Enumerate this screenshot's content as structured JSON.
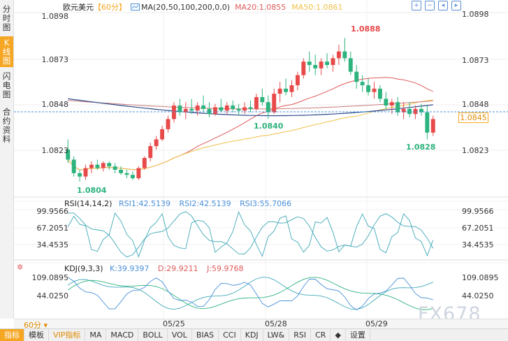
{
  "sidebar": {
    "tabs": [
      {
        "label": "分时图",
        "active": false
      },
      {
        "label": "K线图",
        "active": true
      },
      {
        "label": "闪电图",
        "active": false
      },
      {
        "label": "合约资料",
        "active": false
      }
    ]
  },
  "legend": {
    "symbol": "欧元美元",
    "period": "【60分】",
    "ma_params": "MA(20,50,100,200,0,0)",
    "ma20": "MA20:1.0855",
    "ma50": "MA50:1.0861"
  },
  "tools": [
    "zoom-in-icon",
    "zoom-out-icon",
    "pan-left-icon",
    "pan-right-icon"
  ],
  "price_axis": {
    "ticks": [
      "1.0898",
      "1.0873",
      "1.0848",
      "1.0823"
    ],
    "current": "1.0845"
  },
  "annotations": {
    "high": "1.0888",
    "low": "1.0804",
    "mid_low": "1.0840",
    "recent_low": "1.0828"
  },
  "rsi": {
    "name": "RSI(14,14,2)",
    "rsi1": "RSI1:42.5139",
    "rsi2": "RSI2:42.5139",
    "rsi3": "RSI3:55.7066",
    "ticks": [
      "99.9566",
      "67.2051",
      "34.4535"
    ]
  },
  "kdj": {
    "name": "KDJ(9,3,3)",
    "k": "K:39.9397",
    "d": "D:29.9211",
    "j": "J:59.9768",
    "ticks": [
      "109.0895",
      "44.0250"
    ]
  },
  "dates": [
    "05/25",
    "05/28",
    "05/29"
  ],
  "period_selector": "60分",
  "toolbar": {
    "items": [
      "指标",
      "模板",
      "VIP指标",
      "MA",
      "MACD",
      "BOLL",
      "VOL",
      "BIAS",
      "CCI",
      "KDJ",
      "LW&",
      "RSI",
      "CR",
      "设置"
    ]
  },
  "watermark": "FX678",
  "colors": {
    "up": "#e84a4a",
    "down": "#2db37d",
    "ma20": "#e05a5a",
    "ma50": "#f0c14b",
    "ma100": "#c97a7a",
    "ma200": "#2e4a8a",
    "accent": "#f5a623"
  },
  "chart_data": {
    "type": "candlestick",
    "ylim": [
      1.0798,
      1.0903
    ],
    "candles": [
      [
        1.0822,
        1.0828,
        1.0814,
        1.0816
      ],
      [
        1.0816,
        1.0818,
        1.0806,
        1.0808
      ],
      [
        1.0808,
        1.081,
        1.0803,
        1.0806
      ],
      [
        1.0806,
        1.0813,
        1.0804,
        1.0811
      ],
      [
        1.0811,
        1.0815,
        1.0808,
        1.0813
      ],
      [
        1.0813,
        1.0816,
        1.081,
        1.0811
      ],
      [
        1.0811,
        1.0815,
        1.0809,
        1.0814
      ],
      [
        1.0814,
        1.0815,
        1.081,
        1.0812
      ],
      [
        1.0812,
        1.0814,
        1.0808,
        1.081
      ],
      [
        1.081,
        1.0812,
        1.0807,
        1.0808
      ],
      [
        1.0808,
        1.081,
        1.0805,
        1.0807
      ],
      [
        1.0807,
        1.0809,
        1.0804,
        1.0805
      ],
      [
        1.0805,
        1.0812,
        1.0804,
        1.0811
      ],
      [
        1.0811,
        1.0818,
        1.081,
        1.0817
      ],
      [
        1.0817,
        1.0826,
        1.0815,
        1.0824
      ],
      [
        1.0824,
        1.083,
        1.0822,
        1.0828
      ],
      [
        1.0828,
        1.0836,
        1.0827,
        1.0834
      ],
      [
        1.0834,
        1.0842,
        1.0832,
        1.084
      ],
      [
        1.084,
        1.085,
        1.0838,
        1.0848
      ],
      [
        1.0848,
        1.0852,
        1.0842,
        1.0844
      ],
      [
        1.0844,
        1.085,
        1.084,
        1.0846
      ],
      [
        1.0846,
        1.0852,
        1.0843,
        1.0845
      ],
      [
        1.0845,
        1.085,
        1.0842,
        1.0848
      ],
      [
        1.0848,
        1.0854,
        1.0844,
        1.0846
      ],
      [
        1.0846,
        1.085,
        1.0841,
        1.0843
      ],
      [
        1.0843,
        1.0849,
        1.0842,
        1.0847
      ],
      [
        1.0847,
        1.0852,
        1.0844,
        1.0845
      ],
      [
        1.0845,
        1.085,
        1.0843,
        1.0848
      ],
      [
        1.0848,
        1.0851,
        1.0844,
        1.0846
      ],
      [
        1.0846,
        1.0849,
        1.0842,
        1.0845
      ],
      [
        1.0845,
        1.085,
        1.0843,
        1.0847
      ],
      [
        1.0847,
        1.0851,
        1.0844,
        1.0846
      ],
      [
        1.0846,
        1.0855,
        1.0845,
        1.0853
      ],
      [
        1.0853,
        1.0858,
        1.0848,
        1.085
      ],
      [
        1.085,
        1.0854,
        1.084,
        1.0844
      ],
      [
        1.0844,
        1.0858,
        1.0843,
        1.0855
      ],
      [
        1.0855,
        1.0862,
        1.085,
        1.0858
      ],
      [
        1.0858,
        1.0864,
        1.0854,
        1.0856
      ],
      [
        1.0856,
        1.0863,
        1.0853,
        1.086
      ],
      [
        1.086,
        1.0868,
        1.0857,
        1.0866
      ],
      [
        1.0866,
        1.0876,
        1.0864,
        1.0874
      ],
      [
        1.0874,
        1.088,
        1.0868,
        1.0872
      ],
      [
        1.0872,
        1.0878,
        1.0866,
        1.087
      ],
      [
        1.087,
        1.0876,
        1.0866,
        1.0874
      ],
      [
        1.0874,
        1.0879,
        1.087,
        1.0872
      ],
      [
        1.0872,
        1.0878,
        1.0868,
        1.0876
      ],
      [
        1.0876,
        1.0884,
        1.0872,
        1.088
      ],
      [
        1.088,
        1.0888,
        1.0874,
        1.0876
      ],
      [
        1.0876,
        1.088,
        1.0866,
        1.0868
      ],
      [
        1.0868,
        1.0872,
        1.0858,
        1.0862
      ],
      [
        1.0862,
        1.0866,
        1.0856,
        1.086
      ],
      [
        1.086,
        1.0864,
        1.0854,
        1.0856
      ],
      [
        1.0856,
        1.0862,
        1.0852,
        1.0858
      ],
      [
        1.0858,
        1.086,
        1.085,
        1.0852
      ],
      [
        1.0852,
        1.0856,
        1.0846,
        1.0848
      ],
      [
        1.0848,
        1.0852,
        1.0843,
        1.085
      ],
      [
        1.085,
        1.0853,
        1.0842,
        1.0844
      ],
      [
        1.0844,
        1.085,
        1.084,
        1.0846
      ],
      [
        1.0846,
        1.085,
        1.0841,
        1.0843
      ],
      [
        1.0843,
        1.0848,
        1.084,
        1.0846
      ],
      [
        1.0846,
        1.0849,
        1.0842,
        1.0844
      ],
      [
        1.0844,
        1.0848,
        1.0828,
        1.0832
      ],
      [
        1.0832,
        1.0842,
        1.083,
        1.084
      ]
    ]
  }
}
